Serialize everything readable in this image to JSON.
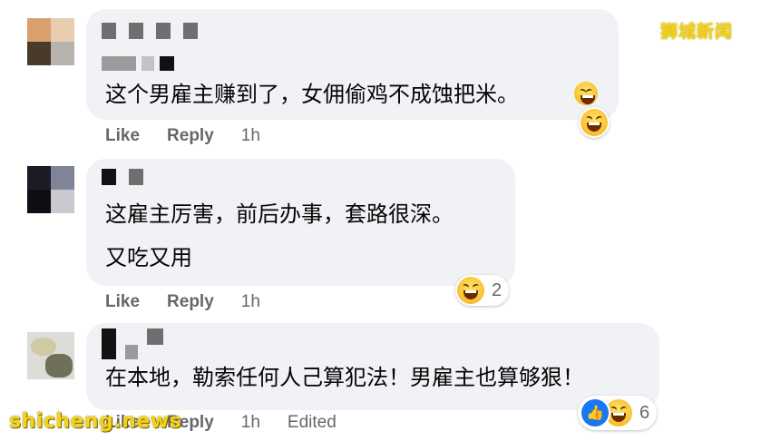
{
  "watermarks": {
    "top": "狮城新闻",
    "bottom": "shicheng.news"
  },
  "comments": [
    {
      "text_lines": [
        "这个男雇主赚到了，女佣偷鸡不成蚀把米。"
      ],
      "actions": {
        "like": "Like",
        "reply": "Reply",
        "time": "1h",
        "edited": ""
      },
      "reaction": {
        "icons": [
          "laughing-emoji"
        ],
        "count": ""
      }
    },
    {
      "text_lines": [
        "这雇主厉害，前后办事，套路很深。",
        "又吃又用"
      ],
      "actions": {
        "like": "Like",
        "reply": "Reply",
        "time": "1h",
        "edited": ""
      },
      "reaction": {
        "icons": [
          "laughing-emoji"
        ],
        "count": "2"
      }
    },
    {
      "text_lines": [
        "在本地，勒索任何人己算犯法！男雇主也算够狠！"
      ],
      "actions": {
        "like": "Like",
        "reply": "Reply",
        "time": "1h",
        "edited": "Edited"
      },
      "reaction": {
        "icons": [
          "like-emoji",
          "laughing-emoji"
        ],
        "count": "6"
      }
    }
  ]
}
